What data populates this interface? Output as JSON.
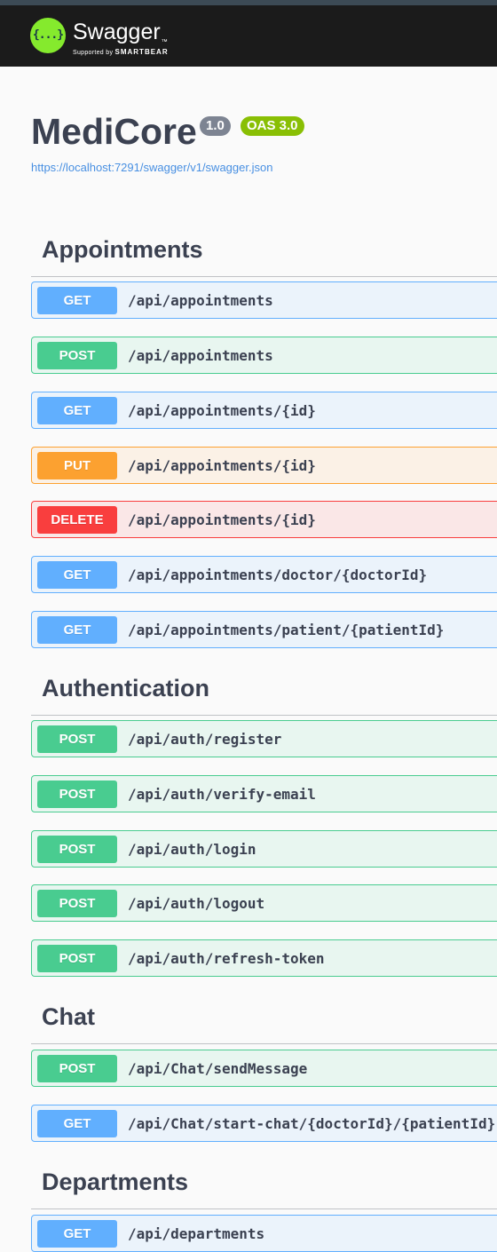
{
  "topbar": {
    "logo_icon": "{...}",
    "brand": "Swagger",
    "brand_tm": "™",
    "supported_by": "Supported by",
    "smartbear": "SMARTBEAR"
  },
  "info": {
    "title": "MediCore",
    "version": "1.0",
    "oas": "OAS 3.0",
    "spec_url": "https://localhost:7291/swagger/v1/swagger.json"
  },
  "colors": {
    "get": "#61affe",
    "post": "#49cc90",
    "put": "#fca130",
    "delete": "#f93e3e"
  },
  "tags": [
    {
      "name": "Appointments",
      "operations": [
        {
          "method": "GET",
          "path": "/api/appointments"
        },
        {
          "method": "POST",
          "path": "/api/appointments"
        },
        {
          "method": "GET",
          "path": "/api/appointments/{id}"
        },
        {
          "method": "PUT",
          "path": "/api/appointments/{id}"
        },
        {
          "method": "DELETE",
          "path": "/api/appointments/{id}"
        },
        {
          "method": "GET",
          "path": "/api/appointments/doctor/{doctorId}"
        },
        {
          "method": "GET",
          "path": "/api/appointments/patient/{patientId}"
        }
      ]
    },
    {
      "name": "Authentication",
      "operations": [
        {
          "method": "POST",
          "path": "/api/auth/register"
        },
        {
          "method": "POST",
          "path": "/api/auth/verify-email"
        },
        {
          "method": "POST",
          "path": "/api/auth/login"
        },
        {
          "method": "POST",
          "path": "/api/auth/logout"
        },
        {
          "method": "POST",
          "path": "/api/auth/refresh-token"
        }
      ]
    },
    {
      "name": "Chat",
      "operations": [
        {
          "method": "POST",
          "path": "/api/Chat/sendMessage"
        },
        {
          "method": "GET",
          "path": "/api/Chat/start-chat/{doctorId}/{patientId}"
        }
      ]
    },
    {
      "name": "Departments",
      "operations": [
        {
          "method": "GET",
          "path": "/api/departments"
        }
      ]
    }
  ]
}
